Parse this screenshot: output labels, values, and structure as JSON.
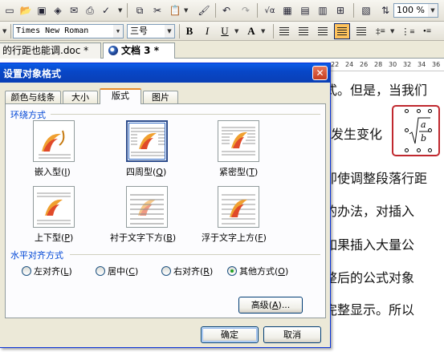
{
  "toolbar": {
    "zoom": "100 %",
    "font_name": "Times New Roman",
    "font_size": "三号",
    "bold": "B",
    "italic": "I",
    "underline": "U",
    "font_color": "A"
  },
  "tabs": [
    {
      "label": "的行距也能调.doc *"
    },
    {
      "label": "文档 3 *"
    }
  ],
  "document": {
    "lines": [
      "式。但是，当我们",
      "发生变化",
      "即使调整段落行距",
      "的办法，对插入",
      "如果插入大量公",
      "整后的公式对象",
      "完整显示。所以"
    ],
    "formula": {
      "numerator": "a",
      "denominator": "b"
    },
    "ruler_ticks": [
      "22",
      "24",
      "26",
      "28",
      "30",
      "32",
      "34",
      "36"
    ]
  },
  "dialog": {
    "title": "设置对象格式",
    "tabs": [
      {
        "label": "颜色与线条"
      },
      {
        "label": "大小"
      },
      {
        "label": "版式"
      },
      {
        "label": "图片"
      }
    ],
    "active_tab": "版式",
    "wrap_group_label": "环绕方式",
    "wrap_options": [
      {
        "label": "嵌入型",
        "key": "I"
      },
      {
        "label": "四周型",
        "key": "Q"
      },
      {
        "label": "紧密型",
        "key": "T"
      },
      {
        "label": "上下型",
        "key": "P"
      },
      {
        "label": "衬于文字下方",
        "key": "B"
      },
      {
        "label": "浮于文字上方",
        "key": "F"
      }
    ],
    "selected_wrap": "四周型",
    "align_group_label": "水平对齐方式",
    "align_options": [
      {
        "label": "左对齐",
        "key": "L"
      },
      {
        "label": "居中",
        "key": "C"
      },
      {
        "label": "右对齐",
        "key": "R"
      },
      {
        "label": "其他方式",
        "key": "O"
      }
    ],
    "selected_align": "其他方式",
    "advanced_button": {
      "label": "高级",
      "key": "A",
      "suffix": "..."
    },
    "ok_button": "确定",
    "cancel_button": "取消"
  },
  "colors": {
    "title_bar": "#0a5ce8",
    "selection_border": "#c0282e",
    "group_label": "#0046d5",
    "active_tab_accent": "#e68b2c"
  }
}
